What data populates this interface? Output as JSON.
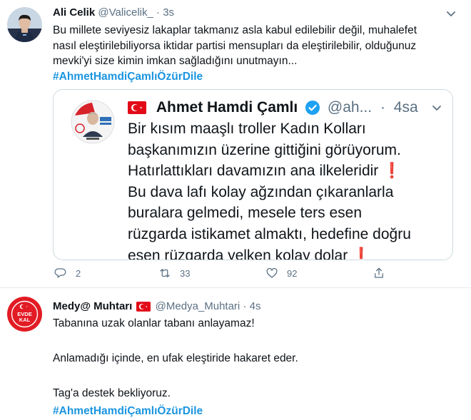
{
  "tweet1": {
    "name": "Ali Celik",
    "handle": "@Valicelik_",
    "sep": "·",
    "time": "3s",
    "lines": [
      "Bu millete seviyesiz lakaplar takmanız asla kabul edilebilir değil, muhalefet",
      "nasıl eleştirilebiliyorsa iktidar  partisi mensupları da eleştirilebilir, olduğunuz",
      "mevki'yi size kimin imkan sağladığını unutmayın..."
    ],
    "hashtag": "#AhmetHamdiÇamlıÖzürDile",
    "quote": {
      "name": "Ahmet Hamdi Çamlı",
      "handle": "@ah...",
      "sep": "·",
      "time": "4sa",
      "lines": [
        "Bir kısım maaşlı troller Kadın Kolları",
        "başkanımızın üzerine gittiğini görüyorum.",
        "Hatırlattıkları davamızın ana ilkeleridir",
        "Bu dava lafı kolay ağzından çıkaranlarla",
        "buralara gelmedi, mesele ters esen",
        "rüzgarda istikamet almaktı, hedefine doğru",
        "esen rüzgarda yelken kolay dolar"
      ],
      "exclaim": "❗"
    },
    "actions": {
      "reply_count": "2",
      "retweet_count": "33",
      "like_count": "92"
    }
  },
  "tweet2": {
    "name": "Medy@ Muhtarı",
    "handle": "@Medya_Muhtari",
    "sep": "·",
    "time": "4s",
    "avatar_text": [
      "EVDE",
      "KAL"
    ],
    "lines": [
      "Tabanına uzak olanlar tabanı anlayamaz!",
      "",
      "Anlamadığı içinde, en ufak eleştiride hakaret eder.",
      "",
      "Tag'a destek bekliyoruz."
    ],
    "hashtag": "#AhmetHamdiÇamlıÖzürDile"
  },
  "colors": {
    "link": "#1b95e0",
    "muted": "#5b7083",
    "border": "#e6ecf0",
    "verified": "#1da1f2",
    "flag": "#e30a17"
  },
  "icons": [
    "reply-icon",
    "retweet-icon",
    "like-icon",
    "share-icon",
    "chevron-down-icon",
    "verified-icon",
    "turkey-flag-icon"
  ]
}
